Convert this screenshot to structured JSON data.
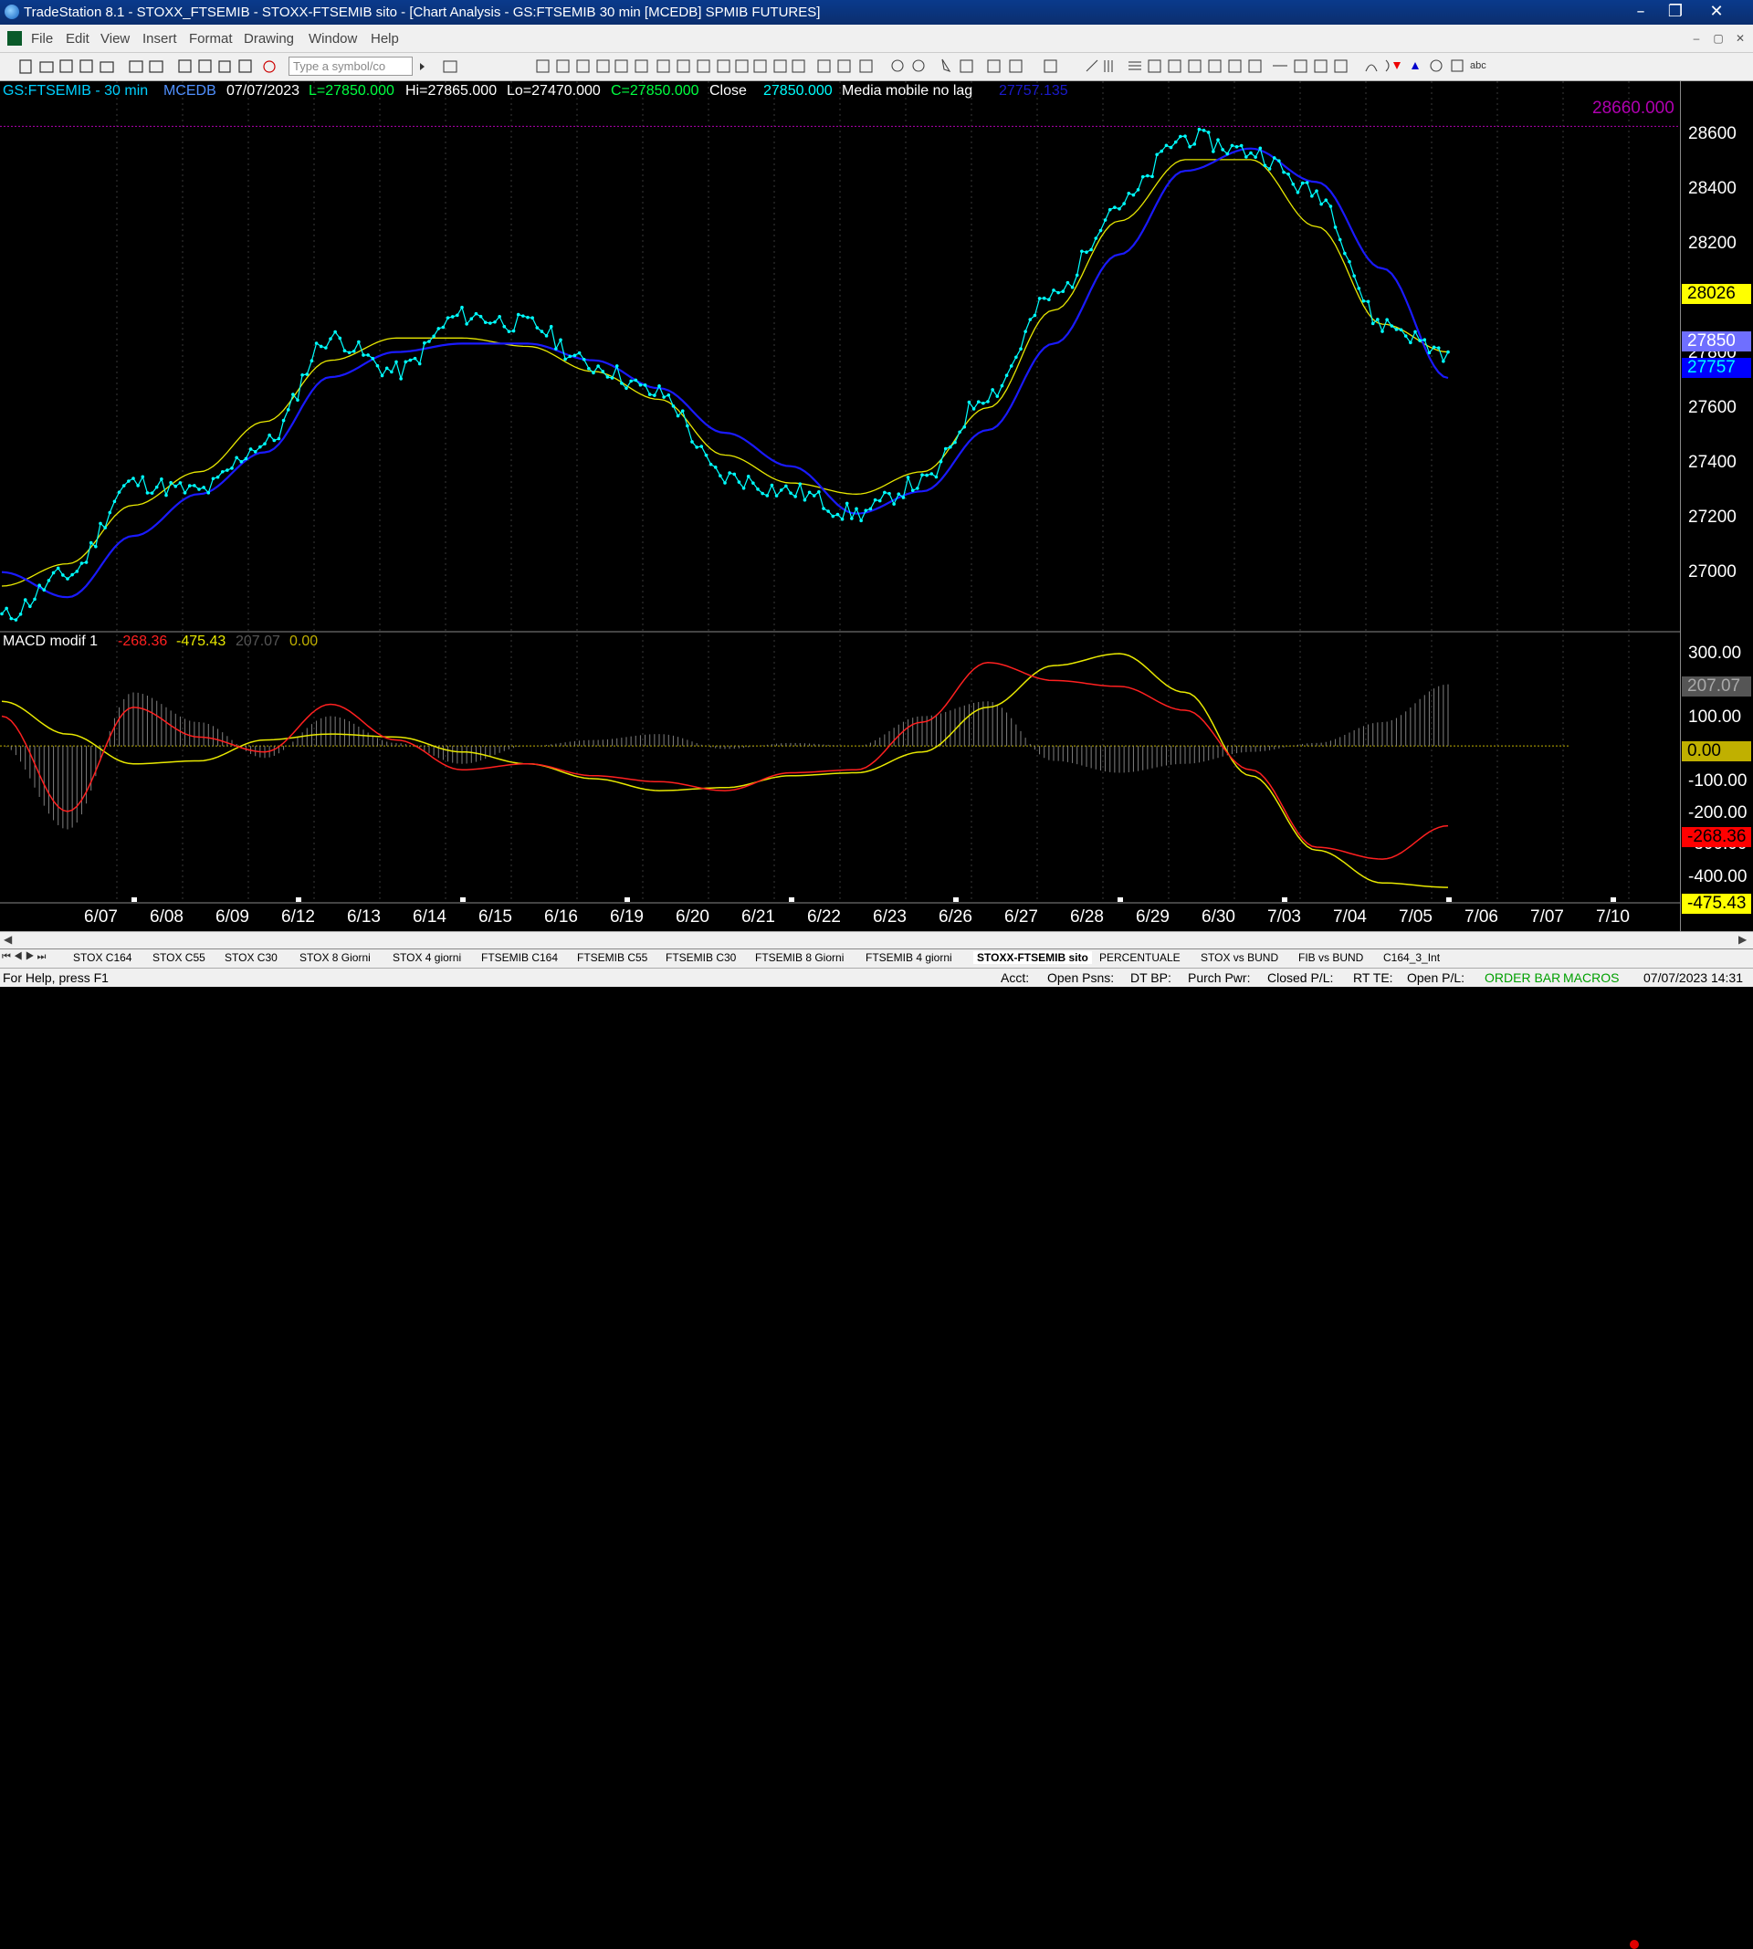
{
  "window": {
    "title": "TradeStation 8.1 - STOXX_FTSEMIB - STOXX-FTSEMIB sito - [Chart Analysis - GS:FTSEMIB  30 min  [MCEDB] SPMIB FUTURES]"
  },
  "menu": [
    "File",
    "Edit",
    "View",
    "Insert",
    "Format",
    "Drawing",
    "Window",
    "Help"
  ],
  "toolbar": {
    "symbol_placeholder": "Type a symbol/co",
    "text_tool": "abc"
  },
  "chart_header": {
    "symbol": "GS:FTSEMIB - 30 min",
    "exchange": "MCEDB",
    "date": "07/07/2023",
    "low_label": "L=27850.000",
    "high_label": "Hi=27865.000",
    "lo_label": "Lo=27470.000",
    "close_label": "C=27850.000",
    "close_word": "Close",
    "close_value": "27850.000",
    "indicator_name": "Media mobile no lag",
    "indicator_value": "27757.135"
  },
  "macd_header": {
    "name": "MACD modif 1",
    "v1": "-268.36",
    "v2": "-475.43",
    "v3": "207.07",
    "v4": "0.00"
  },
  "colors": {
    "price": "#00ffff",
    "slow_ma": "#1a1aff",
    "fast_ma": "#e8e800",
    "macd": "#ff2020",
    "signal": "#e8e800",
    "hist": "#808080",
    "ref_line": "#b000b0"
  },
  "chart_data": [
    {
      "type": "line",
      "title": "",
      "x": [
        "6/07",
        "6/08",
        "6/09",
        "6/12",
        "6/13",
        "6/14",
        "6/15",
        "6/16",
        "6/19",
        "6/20",
        "6/21",
        "6/22",
        "6/23",
        "6/26",
        "6/27",
        "6/28",
        "6/29",
        "6/30",
        "7/03",
        "7/04",
        "7/05",
        "7/06",
        "7/07",
        "7/10"
      ],
      "ylim": [
        26820,
        28720
      ],
      "yticks": [
        "28600",
        "28400",
        "28200",
        "28000",
        "27800",
        "27600",
        "27400",
        "27200",
        "27000"
      ],
      "reference_line": {
        "value": 28660,
        "label": "28660.000"
      },
      "tags": {
        "yellow": "28026",
        "close": "27850",
        "blue": "27757"
      },
      "series": [
        {
          "values": [
            26900,
            27050,
            27380,
            27350,
            27520,
            27900,
            27780,
            27980,
            27950,
            27800,
            27700,
            27400,
            27350,
            27270,
            27380,
            27700,
            28050,
            28380,
            28620,
            28570,
            28420,
            27950,
            27850
          ]
        },
        {
          "values": [
            27010,
            27090,
            27300,
            27420,
            27600,
            27820,
            27900,
            27900,
            27870,
            27780,
            27680,
            27480,
            27380,
            27340,
            27420,
            27650,
            28000,
            28320,
            28540,
            28540,
            28300,
            27950,
            27850
          ]
        },
        {
          "values": [
            27060,
            26970,
            27190,
            27340,
            27490,
            27760,
            27850,
            27880,
            27880,
            27820,
            27720,
            27560,
            27440,
            27270,
            27350,
            27570,
            27880,
            28200,
            28500,
            28580,
            28460,
            28150,
            27757
          ]
        }
      ]
    },
    {
      "type": "line",
      "title": "",
      "x": [
        "6/07",
        "6/08",
        "6/09",
        "6/12",
        "6/13",
        "6/14",
        "6/15",
        "6/16",
        "6/19",
        "6/20",
        "6/21",
        "6/22",
        "6/23",
        "6/26",
        "6/27",
        "6/28",
        "6/29",
        "6/30",
        "7/03",
        "7/04",
        "7/05",
        "7/06",
        "7/07",
        "7/10"
      ],
      "ylim": [
        -530,
        350
      ],
      "yticks": [
        "300.00",
        "100.00",
        "0.00",
        "-100.00",
        "-200.00",
        "-300.00",
        "-400.00"
      ],
      "tags": {
        "hist": "207.07",
        "zero": "0.00",
        "macd": "-268.36",
        "signal": "-475.43"
      },
      "series": [
        {
          "values": [
            100,
            -220,
            130,
            30,
            -20,
            140,
            20,
            -80,
            -60,
            -100,
            -120,
            -150,
            -90,
            -80,
            80,
            280,
            220,
            200,
            120,
            -80,
            -340,
            -380,
            -268
          ]
        },
        {
          "values": [
            150,
            40,
            -60,
            -50,
            20,
            40,
            30,
            -20,
            -60,
            -110,
            -150,
            -140,
            -100,
            -90,
            -20,
            130,
            270,
            310,
            180,
            -100,
            -350,
            -460,
            -475
          ]
        },
        {
          "values": [
            0,
            -280,
            180,
            80,
            -40,
            100,
            10,
            -60,
            0,
            20,
            40,
            -10,
            10,
            0,
            100,
            150,
            -50,
            -90,
            -60,
            -20,
            10,
            80,
            207
          ]
        }
      ]
    }
  ],
  "tabs": [
    "STOX C164",
    "STOX C55",
    "STOX  C30",
    "STOX  8 Giorni",
    "STOX 4 giorni",
    "FTSEMIB C164",
    "FTSEMIB C55",
    "FTSEMIB C30",
    "FTSEMIB  8 Giorni",
    "FTSEMIB  4 giorni",
    "STOXX-FTSEMIB sito",
    "PERCENTUALE",
    "STOX vs BUND",
    "FIB vs BUND",
    "C164_3_Int"
  ],
  "status": {
    "help": "For Help, press F1",
    "acct": "Acct:",
    "open_psns": "Open Psns:",
    "dt_bp": "DT BP:",
    "purch_pwr": "Purch Pwr:",
    "closed_pl": "Closed P/L:",
    "rt_te": "RT TE:",
    "open_pl": "Open P/L:",
    "order_bar": "ORDER BAR",
    "macros": "MACROS",
    "datetime": "07/07/2023 14:31"
  }
}
